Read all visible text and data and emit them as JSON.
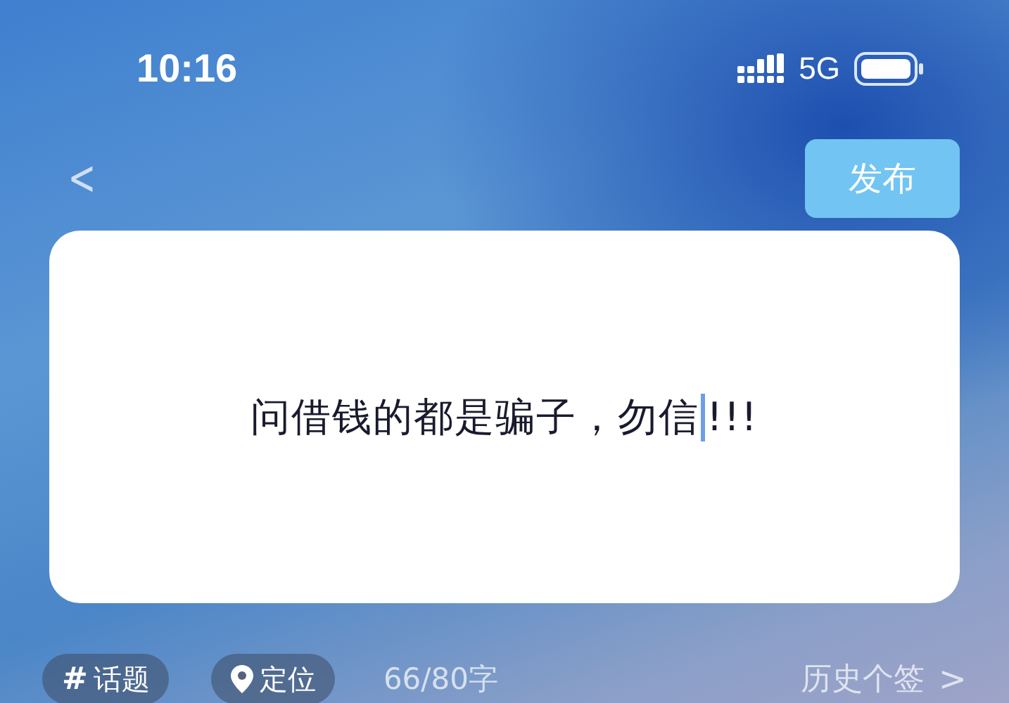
{
  "status_bar": {
    "time": "10:16",
    "network": "5G"
  },
  "nav": {
    "back": "<",
    "publish": {
      "label": "发布",
      "disabled": true
    }
  },
  "editor": {
    "text_before_cursor": "问借钱的都是骗子，勿信",
    "text_after_cursor": "!!!"
  },
  "footer": {
    "chips": [
      {
        "kind": "topic",
        "icon": "#",
        "label": "话题"
      },
      {
        "kind": "location",
        "label": "定位"
      }
    ],
    "counter": "66/80字",
    "history": "历史个签",
    "history_arrow": ">"
  }
}
